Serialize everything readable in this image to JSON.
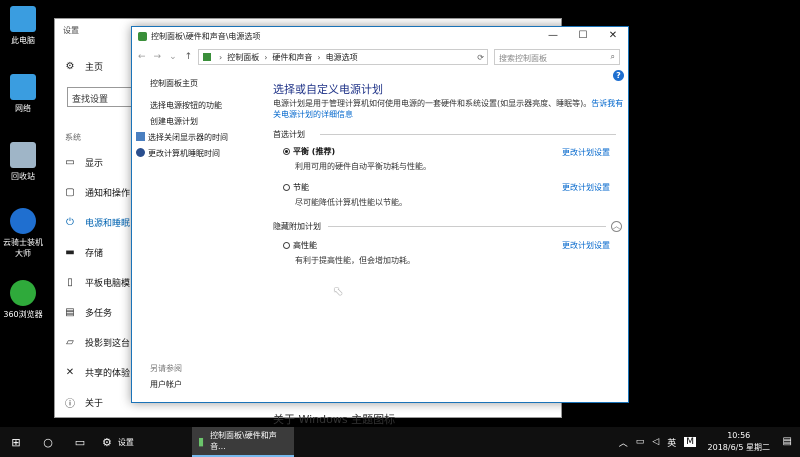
{
  "desktop": {
    "icons": [
      {
        "label": "此电脑",
        "color": "#3a9de0"
      },
      {
        "label": "网络",
        "color": "#3a9de0"
      },
      {
        "label": "回收站",
        "color": "#9fb5c7"
      },
      {
        "label": "云骑士装机大师",
        "color": "#1f6fd0"
      },
      {
        "label": "360浏览器",
        "color": "#2faa3b"
      }
    ]
  },
  "settings": {
    "title": "设置",
    "home": "主页",
    "search_placeholder": "查找设置",
    "category": "系统",
    "nav": [
      "显示",
      "通知和操作",
      "电源和睡眠",
      "存储",
      "平板电脑模",
      "多任务",
      "投影到这台",
      "共享的体验",
      "关于"
    ],
    "selected_index": 2,
    "bottom_text": "关于 Windows 主题图标"
  },
  "control_panel": {
    "window_title": "控制面板\\硬件和声音\\电源选项",
    "breadcrumb": [
      "控制面板",
      "硬件和声音",
      "电源选项"
    ],
    "search_placeholder": "搜索控制面板",
    "help": "?",
    "left_links": [
      "控制面板主页",
      "选择电源按钮的功能",
      "创建电源计划",
      "选择关闭显示器的时间",
      "更改计算机睡眠时间"
    ],
    "see_also": "另请参阅",
    "see_also_link": "用户帐户",
    "heading": "选择或自定义电源计划",
    "description": "电源计划是用于管理计算机如何使用电源的一套硬件和系统设置(如显示器亮度、睡眠等)。",
    "description_link": "告诉我有关电源计划的详细信息",
    "preferred_label": "首选计划",
    "hidden_label": "隐藏附加计划",
    "plans": [
      {
        "name": "平衡 (推荐)",
        "desc": "利用可用的硬件自动平衡功耗与性能。",
        "selected": true
      },
      {
        "name": "节能",
        "desc": "尽可能降低计算机性能以节能。",
        "selected": false
      },
      {
        "name": "高性能",
        "desc": "有利于提高性能，但会增加功耗。",
        "selected": false
      }
    ],
    "change_link": "更改计划设置"
  },
  "taskbar": {
    "apps": [
      {
        "label": "设置"
      },
      {
        "label": "控制面板\\硬件和声音..."
      }
    ],
    "ime": "英",
    "ime2": "M",
    "time": "10:56",
    "date": "2018/6/5 星期二"
  }
}
